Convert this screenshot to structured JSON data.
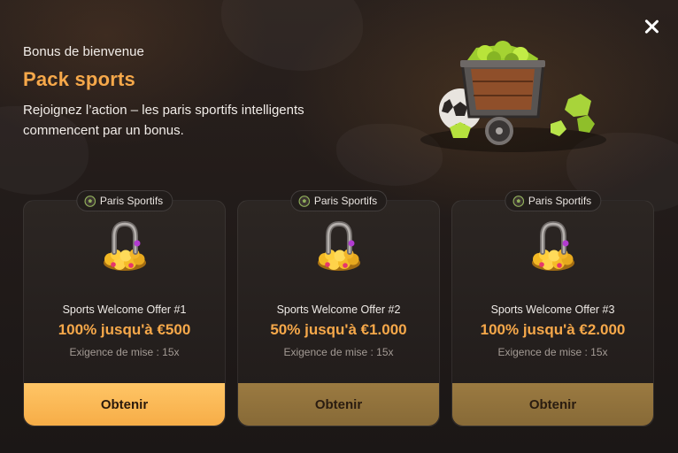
{
  "header": {
    "eyebrow": "Bonus de bienvenue",
    "title": "Pack sports",
    "subtitle": "Rejoignez l’action – les paris sportifs intelligents commencent par un bonus."
  },
  "icons": {
    "close": "close-icon",
    "tag": "sports-ball-icon",
    "card": "gold-horseshoe-icon",
    "hero": "mine-cart-icon"
  },
  "colors": {
    "accent": "#f6a84a",
    "cta_primary": "#f6ad47",
    "cta_secondary": "#876a37",
    "background": "#231c1a"
  },
  "offers": [
    {
      "tag": "Paris Sportifs",
      "name": "Sports Welcome Offer #1",
      "value": "100% jusqu'à €500",
      "wager": "Exigence de mise : 15x",
      "cta": "Obtenir",
      "highlighted": true
    },
    {
      "tag": "Paris Sportifs",
      "name": "Sports Welcome Offer #2",
      "value": "50% jusqu'à €1.000",
      "wager": "Exigence de mise : 15x",
      "cta": "Obtenir",
      "highlighted": false
    },
    {
      "tag": "Paris Sportifs",
      "name": "Sports Welcome Offer #3",
      "value": "100% jusqu'à €2.000",
      "wager": "Exigence de mise : 15x",
      "cta": "Obtenir",
      "highlighted": false
    }
  ]
}
